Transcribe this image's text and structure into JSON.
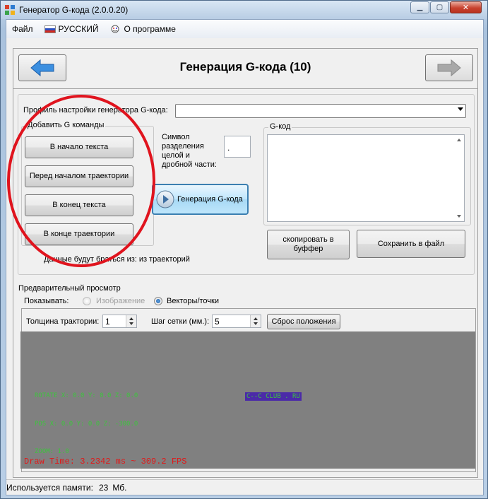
{
  "window": {
    "title": "Генератор G-кода (2.0.0.20)"
  },
  "menu": {
    "file": "Файл",
    "language": "РУССКИЙ",
    "about": "О программе"
  },
  "wizard": {
    "heading": "Генерация G-кода (10)"
  },
  "profile": {
    "label": "Профиль настройки генератора G-кода:",
    "value": ""
  },
  "add_commands": {
    "title": "Добавить G команды",
    "buttons": [
      "В начало текста",
      "Перед началом траектории",
      "В конец текста",
      "В конце траектории"
    ]
  },
  "separator": {
    "label": "Символ разделения целой и дробной части:",
    "label_lines": [
      "Символ",
      "разделения",
      "целой и",
      "дробной части:"
    ],
    "value": "."
  },
  "generate_button": "Генерация G-кода",
  "gcode": {
    "title": "G-код",
    "text": "",
    "copy_button": "скопировать в буффер",
    "save_button": "Сохранить в файл"
  },
  "data_source": "Данные будут браться из: из траекторий",
  "preview": {
    "title": "Предварительный просмотр",
    "show_label": "Показывать:",
    "option_image": "Изображение",
    "option_vectors": "Векторы/точки",
    "selected": "Векторы/точки",
    "thickness_label": "Толщина трактории:",
    "thickness_value": "1",
    "grid_label": "Шаг сетки (мм.):",
    "grid_value": "5",
    "reset_button": "Сброс положения",
    "overlay": {
      "rotate": "ROTATE X: 0.0  Y: 0.0 Z: 0.0",
      "pos": "POS X: 0.0  Y: 0.0 Z: -300.0",
      "zoom": "ZOOM: 1.0",
      "fps": "Draw Time: 3.2342 ms ~ 309.2 FPS",
      "logo": "C--C CLUB . RU"
    }
  },
  "status": {
    "memory_label": "Используется памяти:",
    "memory_value": "23",
    "memory_unit": "Мб."
  },
  "colors": {
    "annotation": "#e0141e",
    "viewport_bg": "#808080",
    "overlay_text": "#3ec23e",
    "fps_text": "#e01818",
    "nav_arrow": "#3b8fe0"
  },
  "icons": [
    "app-icon",
    "russia-flag-icon",
    "about-icon",
    "back-arrow-icon",
    "forward-arrow-icon",
    "play-icon"
  ]
}
